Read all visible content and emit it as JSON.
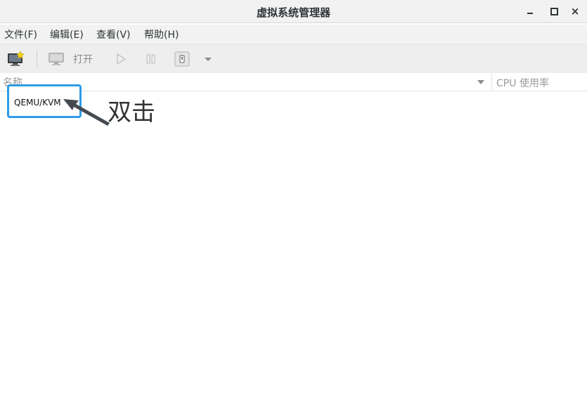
{
  "window": {
    "title": "虚拟系统管理器",
    "buttons": {
      "minimize": "minimize",
      "maximize": "maximize",
      "close": "×"
    }
  },
  "menubar": {
    "items": [
      {
        "label": "文件(F)"
      },
      {
        "label": "编辑(E)"
      },
      {
        "label": "查看(V)"
      },
      {
        "label": "帮助(H)"
      }
    ]
  },
  "toolbar": {
    "new_icon": "new-connection-monitor-icon",
    "open_icon": "monitor-icon",
    "open_label": "打开",
    "run_icon": "play-icon",
    "pause_icon": "pause-icon",
    "shutdown_icon": "power-icon",
    "menu_icon": "dropdown-arrow-icon"
  },
  "list": {
    "columns": {
      "name": "名称",
      "cpu": "CPU 使用率"
    },
    "rows": [
      {
        "name": "QEMU/KVM"
      }
    ]
  },
  "annotation": {
    "text": "双击",
    "color": "#2e9be8"
  }
}
